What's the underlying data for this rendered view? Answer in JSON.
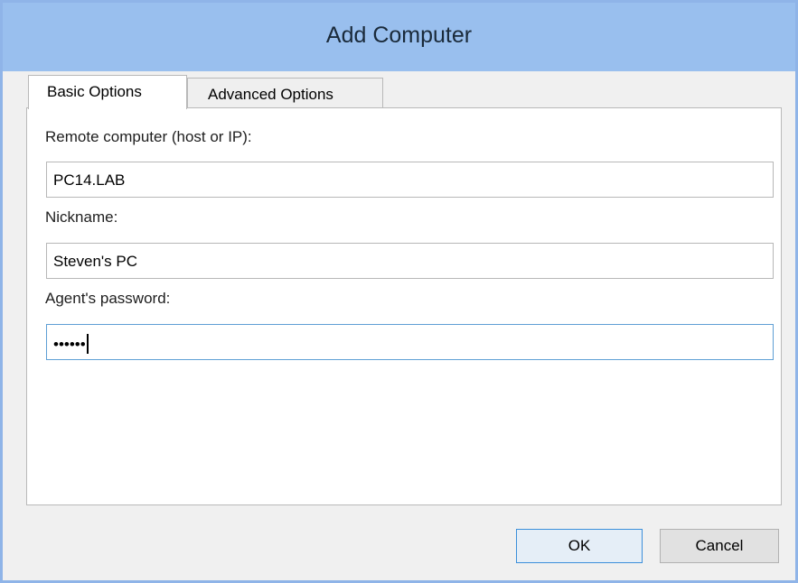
{
  "window": {
    "title": "Add Computer"
  },
  "tabs": [
    {
      "label": "Basic Options",
      "selected": true
    },
    {
      "label": "Advanced Options",
      "selected": false
    }
  ],
  "form": {
    "remote_label": "Remote computer (host or IP):",
    "remote_value": "PC14.LAB",
    "nickname_label": "Nickname:",
    "nickname_value": "Steven's PC",
    "password_label": "Agent's password:",
    "password_value": "••••••"
  },
  "buttons": {
    "ok_label": "OK",
    "cancel_label": "Cancel"
  },
  "colors": {
    "titlebar": "#99bfee",
    "focus_border": "#5e9fd5",
    "ok_border": "#3c8fda"
  }
}
